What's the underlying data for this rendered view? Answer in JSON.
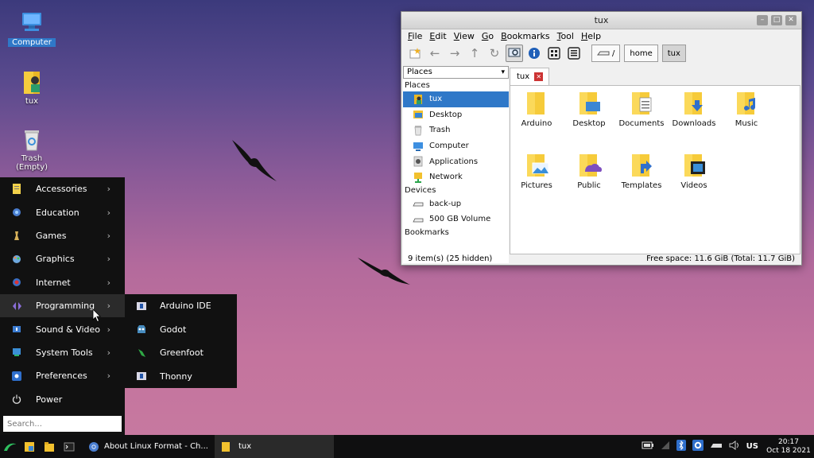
{
  "desktop": {
    "icons": [
      {
        "label": "Computer"
      },
      {
        "label": "tux"
      },
      {
        "label": "Trash\n(Empty)"
      }
    ]
  },
  "start_menu": {
    "items": [
      {
        "label": "Accessories",
        "icon": "accessories-icon"
      },
      {
        "label": "Education",
        "icon": "education-icon"
      },
      {
        "label": "Games",
        "icon": "games-icon"
      },
      {
        "label": "Graphics",
        "icon": "graphics-icon"
      },
      {
        "label": "Internet",
        "icon": "internet-icon"
      },
      {
        "label": "Programming",
        "icon": "programming-icon"
      },
      {
        "label": "Sound & Video",
        "icon": "sound-video-icon"
      },
      {
        "label": "System Tools",
        "icon": "system-tools-icon"
      },
      {
        "label": "Preferences",
        "icon": "preferences-icon"
      },
      {
        "label": "Power",
        "icon": "power-icon"
      }
    ],
    "search_placeholder": "Search...",
    "submenu": [
      {
        "label": "Arduino IDE"
      },
      {
        "label": "Godot"
      },
      {
        "label": "Greenfoot"
      },
      {
        "label": "Thonny"
      }
    ]
  },
  "file_manager": {
    "title": "tux",
    "menubar": [
      "File",
      "Edit",
      "View",
      "Go",
      "Bookmarks",
      "Tool",
      "Help"
    ],
    "breadcrumbs": [
      "/",
      "home",
      "tux"
    ],
    "places_select": "Places",
    "sidebar": {
      "places_header": "Places",
      "places": [
        "tux",
        "Desktop",
        "Trash",
        "Computer",
        "Applications",
        "Network"
      ],
      "devices_header": "Devices",
      "devices": [
        "back-up",
        "500 GB Volume"
      ],
      "bookmarks_header": "Bookmarks"
    },
    "tab": "tux",
    "files": [
      "Arduino",
      "Desktop",
      "Documents",
      "Downloads",
      "Music",
      "Pictures",
      "Public",
      "Templates",
      "Videos"
    ],
    "status_left": "9 item(s) (25 hidden)",
    "status_right": "Free space: 11.6 GiB (Total: 11.7 GiB)"
  },
  "taskbar": {
    "tasks": [
      "About Linux Format - Ch...",
      "tux"
    ],
    "keyboard_layout": "US",
    "time": "20:17",
    "date": "Oct 18 2021"
  },
  "colors": {
    "selection": "#2f78c8",
    "menu_bg": "#111111",
    "folder": "#f2c12e"
  }
}
